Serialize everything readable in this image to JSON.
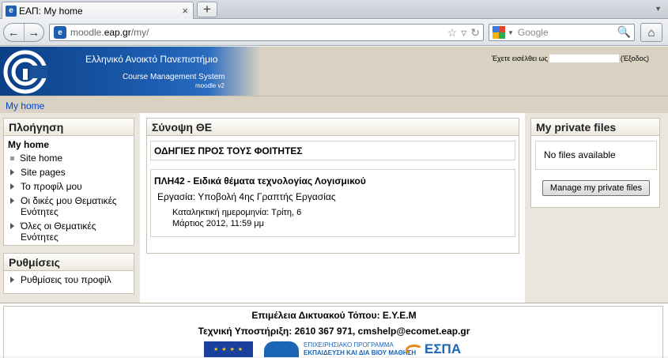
{
  "browser": {
    "tab_title": "ΕΑΠ: My home",
    "tab_close": "×",
    "new_tab": "+",
    "url_prefix": "moodle.",
    "url_domain": "eap.gr",
    "url_suffix": "/my/",
    "search_placeholder": "Google"
  },
  "header": {
    "site_name": "Ελληνικό Ανοικτό Πανεπιστήμιο",
    "site_subtitle": "Course Management System",
    "site_version": "moodle v2",
    "login_prefix": "Έχετε εισέλθει ως",
    "logout_label": "(Έξοδος)"
  },
  "breadcrumb": {
    "my_home": "My home"
  },
  "navigation": {
    "title": "Πλοήγηση",
    "home": "My home",
    "items": [
      {
        "label": "Site home",
        "icon": "square-bullet"
      },
      {
        "label": "Site pages",
        "icon": "expand-arrow"
      },
      {
        "label": "Το προφίλ μου",
        "icon": "expand-arrow"
      },
      {
        "label": "Οι δικές μου Θεματικές Ενότητες",
        "icon": "expand-arrow"
      },
      {
        "label": "Όλες οι Θεματικές Ενότητες",
        "icon": "expand-arrow"
      }
    ]
  },
  "settings": {
    "title": "Ρυθμίσεις",
    "items": [
      {
        "label": "Ρυθμίσεις του προφίλ"
      }
    ]
  },
  "summary": {
    "title": "Σύνοψη ΘΕ",
    "notice": "ΟΔΗΓΙΕΣ ΠΡΟΣ ΤΟΥΣ ΦΟΙΤΗΤΕΣ",
    "course_title": "ΠΛΗ42 - Ειδικά θέματα τεχνολογίας Λογισμικού",
    "assignment_prefix": "Εργασία:",
    "assignment_name": "Υποβολή 4ης Γραπτής Εργασίας",
    "deadline_line1": "Καταληκτική ημερομηνία: Τρίτη, 6",
    "deadline_line2": "Μάρτιος 2012, 11:59 μμ"
  },
  "private_files": {
    "title": "My private files",
    "empty_text": "No files available",
    "manage_button": "Manage my private files"
  },
  "footer": {
    "line1": "Επιμέλεια Δικτυακού Τόπου: Ε.Υ.Ε.Μ",
    "line2": "Τεχνική Υποστήριξη: 2610 367 971, cmshelp@ecomet.eap.gr",
    "epan_line1": "ΕΠΙΧΕΙΡΗΣΙΑΚΟ ΠΡΟΓΡΑΜΜΑ",
    "epan_line2": "ΕΚΠΑΙΔΕΥΣΗ ΚΑΙ ΔΙΑ ΒΙΟΥ ΜΑΘΗΣΗ",
    "espa_logo": "ΕΣΠΑ"
  },
  "colors": {
    "banner_blue": "#1d5db0",
    "banner_beige": "#d9d2c3",
    "link": "#0044cc"
  }
}
